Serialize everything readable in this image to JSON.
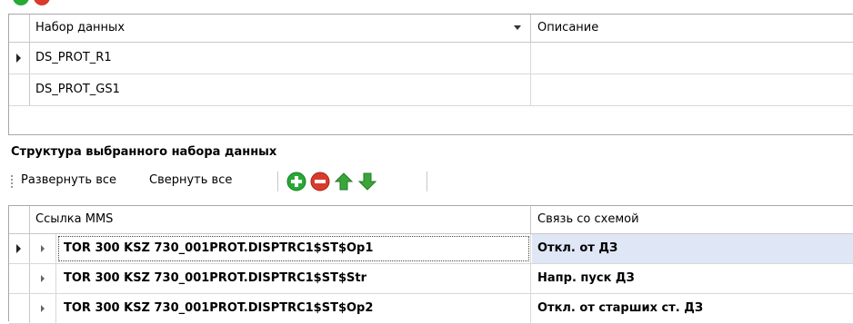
{
  "toolbar_top": {
    "icons": [
      "add-icon",
      "remove-icon"
    ]
  },
  "datasets_grid": {
    "columns": [
      "Набор данных",
      "Описание"
    ],
    "rows": [
      {
        "name": "DS_PROT_R1",
        "description": "",
        "current": true
      },
      {
        "name": "DS_PROT_GS1",
        "description": "",
        "current": false
      }
    ]
  },
  "structure": {
    "title": "Структура выбранного набора данных",
    "toolbar": {
      "expand_all": "Развернуть все",
      "collapse_all": "Свернуть все",
      "icons": [
        "add-icon",
        "remove-icon",
        "arrow-up-icon",
        "arrow-down-icon"
      ]
    },
    "columns": [
      "Ссылка MMS",
      "Связь со схемой"
    ],
    "rows": [
      {
        "mms_ref": "TOR 300 KSZ 730_001PROT.DISPTRC1$ST$Op1",
        "scheme_link": "Откл. от ДЗ",
        "selected": true
      },
      {
        "mms_ref": "TOR 300 KSZ 730_001PROT.DISPTRC1$ST$Str",
        "scheme_link": "Напр. пуск ДЗ",
        "selected": false
      },
      {
        "mms_ref": "TOR 300 KSZ 730_001PROT.DISPTRC1$ST$Op2",
        "scheme_link": "Откл. от старших ст. ДЗ",
        "selected": false
      }
    ]
  },
  "colors": {
    "add": "#27a935",
    "remove": "#d93a2b",
    "arrows": "#3aa53a",
    "selection": "#dfe6f5"
  }
}
